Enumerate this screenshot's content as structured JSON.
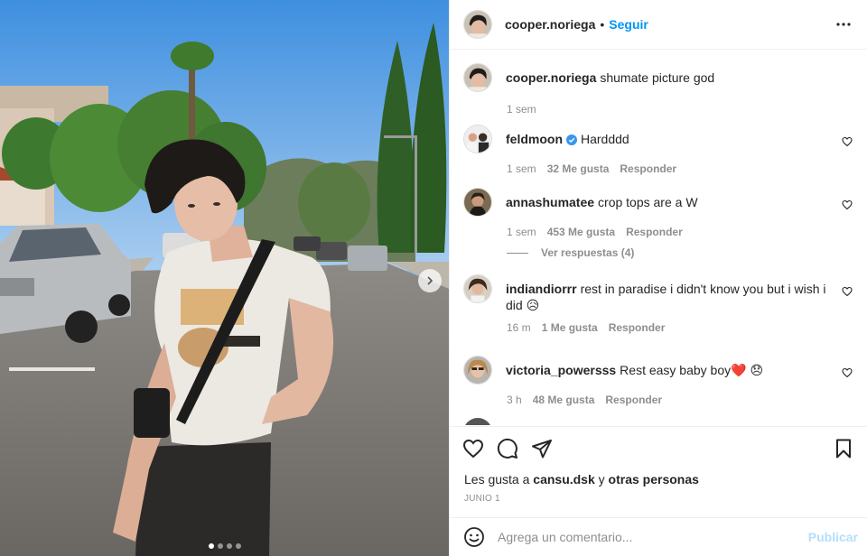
{
  "post": {
    "username": "cooper.noriega",
    "follow_label": "Seguir",
    "caption": {
      "username": "cooper.noriega",
      "text": "shumate picture god",
      "time": "1 sem"
    },
    "carousel": {
      "total": 4,
      "active_index": 1
    }
  },
  "comments": [
    {
      "username": "feldmoon",
      "verified": true,
      "text": "Hardddd",
      "time": "1 sem",
      "likes": "32 Me gusta",
      "reply": "Responder"
    },
    {
      "username": "annashumatee",
      "verified": false,
      "text": "crop tops are a W",
      "time": "1 sem",
      "likes": "453 Me gusta",
      "reply": "Responder",
      "view_replies": "Ver respuestas (4)"
    },
    {
      "username": "indiandiorrr",
      "verified": false,
      "text": "rest in paradise i didn't know you but i wish i did 😥",
      "time": "16 m",
      "likes": "1 Me gusta",
      "reply": "Responder"
    },
    {
      "username": "victoria_powersss",
      "verified": false,
      "text": "Rest easy baby boy❤️ 😞",
      "time": "3 h",
      "likes": "48 Me gusta",
      "reply": "Responder"
    }
  ],
  "likes_summary": {
    "prefix": "Les gusta a ",
    "user": "cansu.dsk",
    "middle": " y ",
    "others": "otras personas"
  },
  "date": "JUNIO 1",
  "add_comment": {
    "placeholder": "Agrega un comentario...",
    "publish_label": "Publicar"
  },
  "icons": {
    "like": "heart-icon",
    "comment": "comment-icon",
    "share": "send-icon",
    "save": "bookmark-icon",
    "more": "more-options-icon",
    "emoji": "emoji-icon"
  },
  "colors": {
    "accent": "#0095f6",
    "publish_disabled": "#b2dffc",
    "muted": "#8e8e8e",
    "text": "#262626",
    "verified": "#3897f0"
  }
}
